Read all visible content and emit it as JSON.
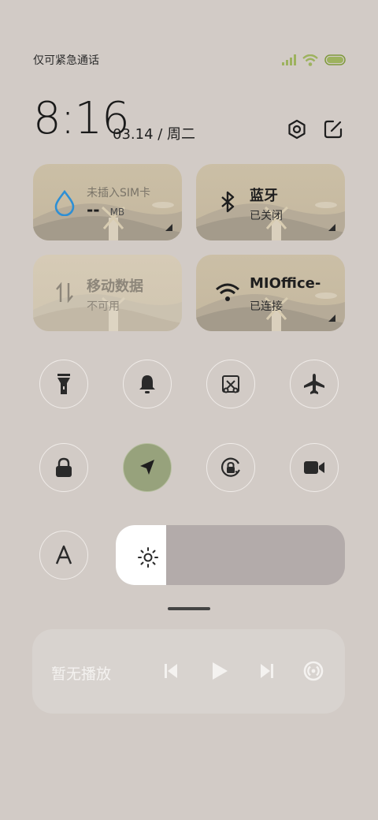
{
  "status_bar": {
    "carrier_text": "仅可紧急通话",
    "icons": [
      "signal-icon",
      "wifi-icon",
      "battery-icon"
    ],
    "accent_color": "#9db25e"
  },
  "header": {
    "time": "8:16",
    "date": "03.14 / 周二",
    "icons": [
      "settings-icon",
      "edit-icon"
    ]
  },
  "cards": [
    {
      "id": "sim",
      "icon": "water-drop-icon",
      "title": "--",
      "title_unit": "MB",
      "subtitle": "未插入SIM卡"
    },
    {
      "id": "bluetooth",
      "icon": "bluetooth-icon",
      "title": "蓝牙",
      "subtitle": "已关闭"
    },
    {
      "id": "mobile-data",
      "icon": "data-arrows-icon",
      "title": "移动数据",
      "subtitle": "不可用"
    },
    {
      "id": "wifi",
      "icon": "wifi-icon",
      "title": "MIOffice-",
      "subtitle": "已连接"
    }
  ],
  "toggles": [
    {
      "icon": "flashlight-icon",
      "active": false
    },
    {
      "icon": "bell-icon",
      "active": false
    },
    {
      "icon": "screenshot-icon",
      "active": false
    },
    {
      "icon": "airplane-icon",
      "active": false
    },
    {
      "icon": "lock-icon",
      "active": false
    },
    {
      "icon": "location-icon",
      "active": true
    },
    {
      "icon": "rotation-lock-icon",
      "active": false
    },
    {
      "icon": "video-camera-icon",
      "active": false
    },
    {
      "icon": "auto-brightness-icon",
      "active": false
    }
  ],
  "brightness": {
    "level_fraction": 0.22,
    "icon": "sun-icon"
  },
  "media": {
    "label": "暂无播放",
    "controls": [
      "previous-icon",
      "play-icon",
      "next-icon",
      "cast-icon"
    ]
  },
  "colors": {
    "background": "#d2cbc6",
    "active_toggle": "#97a27c",
    "card": "#cbbfa6"
  }
}
